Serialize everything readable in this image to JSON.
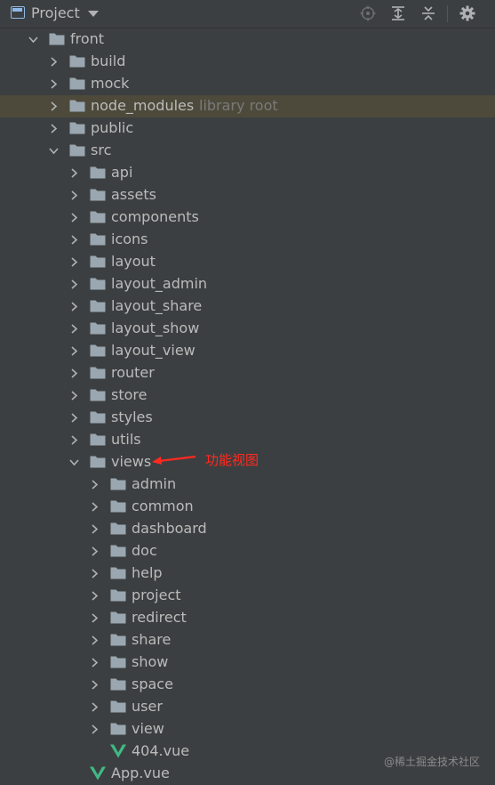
{
  "toolbar": {
    "title": "Project",
    "icons": [
      "project-window-icon",
      "dropdown-caret-icon",
      "locate-target-icon",
      "expand-all-icon",
      "collapse-all-icon",
      "settings-gear-icon"
    ]
  },
  "tree": [
    {
      "label": "front",
      "type": "folder",
      "depth": 0,
      "expanded": true
    },
    {
      "label": "build",
      "type": "folder",
      "depth": 1,
      "expanded": false
    },
    {
      "label": "mock",
      "type": "folder",
      "depth": 1,
      "expanded": false
    },
    {
      "label": "node_modules",
      "hint": "library root",
      "type": "folder",
      "depth": 1,
      "expanded": false,
      "selected": true
    },
    {
      "label": "public",
      "type": "folder",
      "depth": 1,
      "expanded": false
    },
    {
      "label": "src",
      "type": "folder",
      "depth": 1,
      "expanded": true
    },
    {
      "label": "api",
      "type": "folder",
      "depth": 2,
      "expanded": false
    },
    {
      "label": "assets",
      "type": "folder",
      "depth": 2,
      "expanded": false
    },
    {
      "label": "components",
      "type": "folder",
      "depth": 2,
      "expanded": false
    },
    {
      "label": "icons",
      "type": "folder",
      "depth": 2,
      "expanded": false
    },
    {
      "label": "layout",
      "type": "folder",
      "depth": 2,
      "expanded": false
    },
    {
      "label": "layout_admin",
      "type": "folder",
      "depth": 2,
      "expanded": false
    },
    {
      "label": "layout_share",
      "type": "folder",
      "depth": 2,
      "expanded": false
    },
    {
      "label": "layout_show",
      "type": "folder",
      "depth": 2,
      "expanded": false
    },
    {
      "label": "layout_view",
      "type": "folder",
      "depth": 2,
      "expanded": false
    },
    {
      "label": "router",
      "type": "folder",
      "depth": 2,
      "expanded": false
    },
    {
      "label": "store",
      "type": "folder",
      "depth": 2,
      "expanded": false
    },
    {
      "label": "styles",
      "type": "folder",
      "depth": 2,
      "expanded": false
    },
    {
      "label": "utils",
      "type": "folder",
      "depth": 2,
      "expanded": false
    },
    {
      "label": "views",
      "type": "folder",
      "depth": 2,
      "expanded": true
    },
    {
      "label": "admin",
      "type": "folder",
      "depth": 3,
      "expanded": false
    },
    {
      "label": "common",
      "type": "folder",
      "depth": 3,
      "expanded": false
    },
    {
      "label": "dashboard",
      "type": "folder",
      "depth": 3,
      "expanded": false
    },
    {
      "label": "doc",
      "type": "folder",
      "depth": 3,
      "expanded": false
    },
    {
      "label": "help",
      "type": "folder",
      "depth": 3,
      "expanded": false
    },
    {
      "label": "project",
      "type": "folder",
      "depth": 3,
      "expanded": false
    },
    {
      "label": "redirect",
      "type": "folder",
      "depth": 3,
      "expanded": false
    },
    {
      "label": "share",
      "type": "folder",
      "depth": 3,
      "expanded": false
    },
    {
      "label": "show",
      "type": "folder",
      "depth": 3,
      "expanded": false
    },
    {
      "label": "space",
      "type": "folder",
      "depth": 3,
      "expanded": false
    },
    {
      "label": "user",
      "type": "folder",
      "depth": 3,
      "expanded": false
    },
    {
      "label": "view",
      "type": "folder",
      "depth": 3,
      "expanded": false
    },
    {
      "label": "404.vue",
      "type": "vue",
      "depth": 3
    },
    {
      "label": "App.vue",
      "type": "vue",
      "depth": 2
    }
  ],
  "annotation": {
    "text": "功能视图",
    "color": "#ff2a1f"
  },
  "watermark": "@稀土掘金技术社区",
  "colors": {
    "background": "#3c3f41",
    "text": "#bbbbbb",
    "selected_row": "#4d4a3b",
    "folder": "#9aa7b0",
    "vue_green": "#41b883"
  }
}
